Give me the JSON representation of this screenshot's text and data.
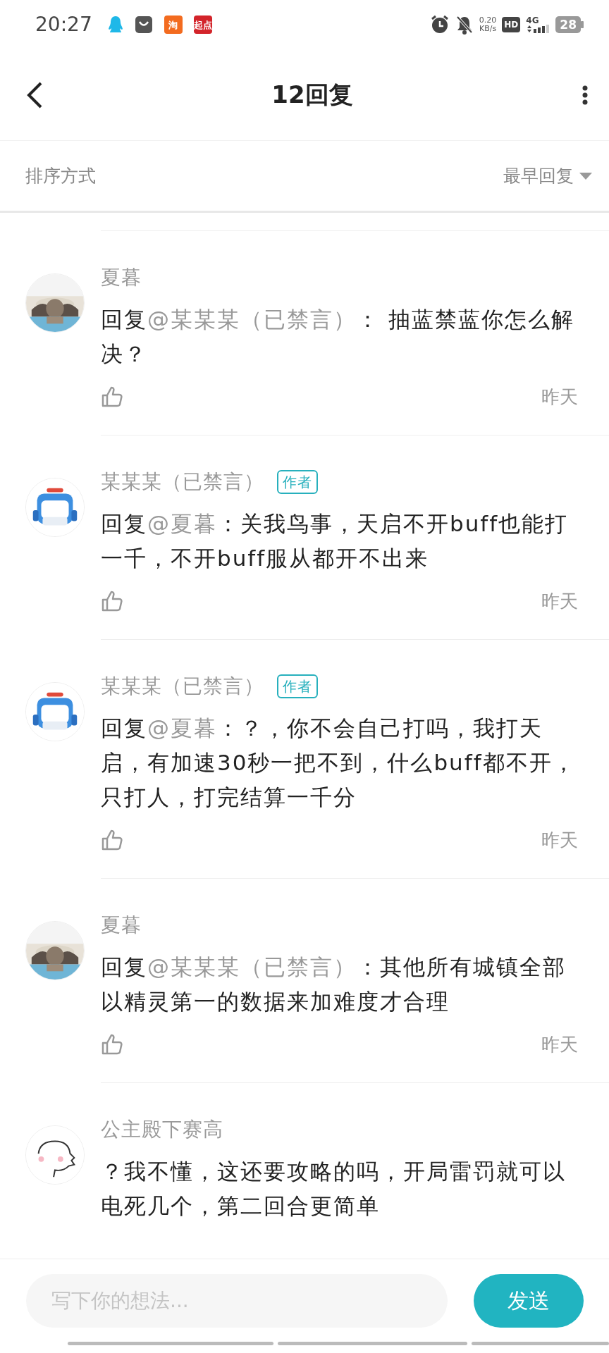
{
  "status_bar": {
    "time": "20:27",
    "app_icons": [
      {
        "kind": "qq"
      },
      {
        "kind": "bag"
      },
      {
        "kind": "tile",
        "label": "淘",
        "color": "#f36b1f"
      },
      {
        "kind": "tile",
        "label": "起点",
        "color": "#d3242a"
      }
    ],
    "net_speed": "0.20",
    "net_unit": "KB/s",
    "hd": "HD",
    "network": "4G",
    "battery": "28"
  },
  "header": {
    "title": "12回复"
  },
  "sort": {
    "label": "排序方式",
    "value": "最早回复"
  },
  "comments": [
    {
      "author": "夏暮",
      "prefix": "回复",
      "mention": "@某某某（已禁言）",
      "text": "： 抽蓝禁蓝你怎么解决？",
      "time": "昨天"
    },
    {
      "author": "某某某（已禁言）",
      "avatar": {
        "kind": "cartoon"
      },
      "badge": "作者",
      "prefix": "回复",
      "mention": "@夏暮",
      "text": "：关我鸟事，天启不开buff也能打一千，不开buff服从都开不出来",
      "time": "昨天"
    },
    {
      "author": "某某某（已禁言）",
      "avatar": {
        "kind": "cartoon"
      },
      "badge": "作者",
      "prefix": "回复",
      "mention": "@夏暮",
      "text": "：？，你不会自己打吗，我打天启，有加速30秒一把不到，什么buff都不开，只打人，打完结算一千分",
      "time": "昨天"
    },
    {
      "author": "夏暮",
      "prefix": "回复",
      "mention": "@某某某（已禁言）",
      "text": "：其他所有城镇全部以精灵第一的数据来加难度才合理",
      "time": "昨天"
    },
    {
      "author": "公主殿下赛高",
      "avatar": {
        "kind": "sketch"
      },
      "text": "？我不懂，这还要攻略的吗，开局雷罚就可以电死几个，第二回合更简单"
    }
  ],
  "composer": {
    "placeholder": "写下你的想法...",
    "send": "发送"
  }
}
